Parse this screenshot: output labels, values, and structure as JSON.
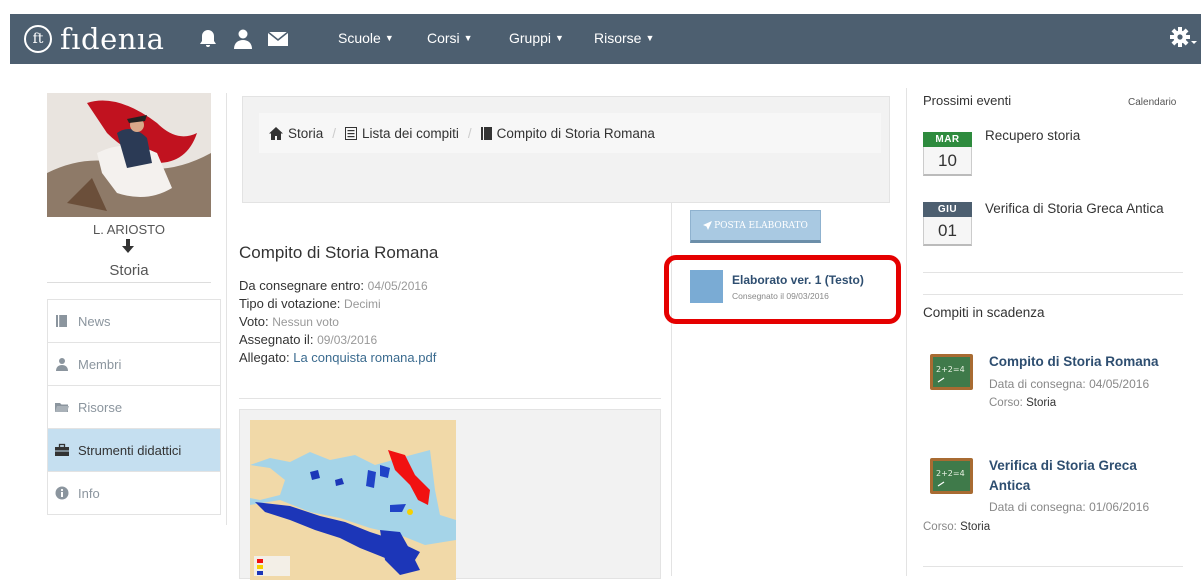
{
  "nav": {
    "brand_mark": "ft",
    "brand": "fıdenıa",
    "menus": [
      {
        "label": "Scuole"
      },
      {
        "label": "Corsi"
      },
      {
        "label": "Gruppi"
      },
      {
        "label": "Risorse"
      }
    ],
    "accent": "#4d5f70"
  },
  "sidebar": {
    "teacher": "L. ARIOSTO",
    "course": "Storia",
    "items": [
      {
        "label": "News",
        "icon": "book-icon"
      },
      {
        "label": "Membri",
        "icon": "user-icon"
      },
      {
        "label": "Risorse",
        "icon": "folder-icon"
      },
      {
        "label": "Strumenti didattici",
        "icon": "briefcase-icon",
        "active": true
      },
      {
        "label": "Info",
        "icon": "info-icon"
      }
    ]
  },
  "breadcrumb": {
    "home": "Storia",
    "list": "Lista dei compiti",
    "current": "Compito di Storia Romana"
  },
  "task": {
    "title": "Compito di Storia Romana",
    "due_label": "Da consegnare entro:",
    "due_value": "04/05/2016",
    "vote_type_label": "Tipo di votazione:",
    "vote_type_value": "Decimi",
    "vote_label": "Voto:",
    "vote_value": "Nessun voto",
    "assigned_label": "Assegnato il:",
    "assigned_value": "09/03/2016",
    "attachment_label": "Allegato:",
    "attachment_value": "La conquista romana.pdf"
  },
  "submission": {
    "button_label": "POSTA ELABORATO",
    "title": "Elaborato ver. 1 (Testo)",
    "date": "Consegnato il 09/03/2016",
    "highlight_color": "#e50000"
  },
  "events": {
    "title": "Prossimi eventi",
    "calendar_link": "Calendario",
    "items": [
      {
        "month": "MAR",
        "day": "10",
        "name": "Recupero storia",
        "color": "#2e8b3e"
      },
      {
        "month": "GIU",
        "day": "01",
        "name": "Verifica di Storia Greca Antica",
        "color": "#4d5f70"
      }
    ]
  },
  "due": {
    "title": "Compiti in scadenza",
    "items": [
      {
        "name": "Compito di Storia Romana",
        "date": "Data di consegna: 04/05/2016",
        "course_label": "Corso:",
        "course": "Storia"
      },
      {
        "name_line1": "Verifica di Storia Greca",
        "name_line2": "Antica",
        "date": "Data di consegna: 01/06/2016",
        "course_label": "Corso:",
        "course": "Storia"
      }
    ]
  }
}
